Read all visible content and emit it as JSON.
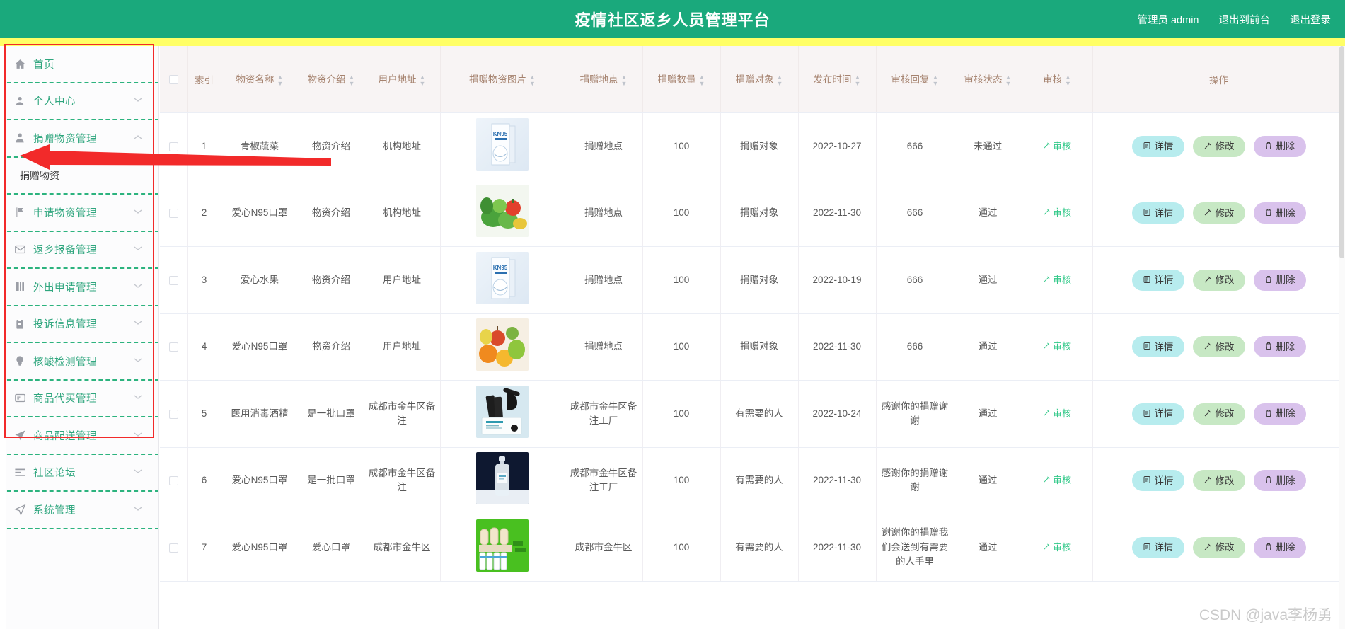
{
  "header": {
    "title": "疫情社区返乡人员管理平台",
    "user_label": "管理员 admin",
    "exit_front_label": "退出到前台",
    "logout_label": "退出登录",
    "bg_color": "#1aa97c",
    "accent_bar_color": "#ffff66"
  },
  "sidebar": {
    "items": [
      {
        "label": "首页",
        "icon": "home-icon",
        "expandable": false,
        "expanded": false
      },
      {
        "label": "个人中心",
        "icon": "user-icon",
        "expandable": true,
        "expanded": false
      },
      {
        "label": "捐赠物资管理",
        "icon": "person-filled-icon",
        "expandable": true,
        "expanded": true
      },
      {
        "label": "申请物资管理",
        "icon": "flag-icon",
        "expandable": true,
        "expanded": false
      },
      {
        "label": "返乡报备管理",
        "icon": "envelope-icon",
        "expandable": true,
        "expanded": false
      },
      {
        "label": "外出申请管理",
        "icon": "book-icon",
        "expandable": true,
        "expanded": false
      },
      {
        "label": "投诉信息管理",
        "icon": "clipboard-icon",
        "expandable": true,
        "expanded": false
      },
      {
        "label": "核酸检测管理",
        "icon": "bulb-icon",
        "expandable": true,
        "expanded": false
      },
      {
        "label": "商品代买管理",
        "icon": "card-icon",
        "expandable": true,
        "expanded": false
      },
      {
        "label": "商品配送管理",
        "icon": "send-icon",
        "expandable": true,
        "expanded": false
      },
      {
        "label": "社区论坛",
        "icon": "list-icon",
        "expandable": true,
        "expanded": false
      },
      {
        "label": "系统管理",
        "icon": "navigation-icon",
        "expandable": true,
        "expanded": false
      }
    ],
    "submenu": {
      "label": "捐赠物资",
      "parent": "捐赠物资管理"
    }
  },
  "table": {
    "columns": [
      {
        "key": "checkbox",
        "label": "",
        "sortable": false
      },
      {
        "key": "index",
        "label": "索引",
        "sortable": false
      },
      {
        "key": "name",
        "label": "物资名称",
        "sortable": true
      },
      {
        "key": "intro",
        "label": "物资介绍",
        "sortable": true
      },
      {
        "key": "user_address",
        "label": "用户地址",
        "sortable": true
      },
      {
        "key": "image",
        "label": "捐赠物资图片",
        "sortable": true
      },
      {
        "key": "place",
        "label": "捐赠地点",
        "sortable": true
      },
      {
        "key": "quantity",
        "label": "捐赠数量",
        "sortable": true
      },
      {
        "key": "target",
        "label": "捐赠对象",
        "sortable": true
      },
      {
        "key": "publish_time",
        "label": "发布时间",
        "sortable": true
      },
      {
        "key": "audit_reply",
        "label": "审核回复",
        "sortable": true
      },
      {
        "key": "audit_status",
        "label": "审核状态",
        "sortable": true
      },
      {
        "key": "audit",
        "label": "审核",
        "sortable": true
      },
      {
        "key": "operations",
        "label": "操作",
        "sortable": false
      }
    ],
    "audit_link_label": "审核",
    "buttons": {
      "detail": "详情",
      "edit": "修改",
      "delete": "删除"
    },
    "rows": [
      {
        "index": "1",
        "name": "青椒蔬菜",
        "intro": "物资介绍",
        "user_address": "机构地址",
        "image": "kn95-box",
        "place": "捐赠地点",
        "quantity": "100",
        "target": "捐赠对象",
        "publish_time": "2022-10-27",
        "audit_reply": "666",
        "audit_status": "未通过"
      },
      {
        "index": "2",
        "name": "爱心N95口罩",
        "intro": "物资介绍",
        "user_address": "机构地址",
        "image": "vegetables",
        "place": "捐赠地点",
        "quantity": "100",
        "target": "捐赠对象",
        "publish_time": "2022-11-30",
        "audit_reply": "666",
        "audit_status": "通过"
      },
      {
        "index": "3",
        "name": "爱心水果",
        "intro": "物资介绍",
        "user_address": "用户地址",
        "image": "kn95-box",
        "place": "捐赠地点",
        "quantity": "100",
        "target": "捐赠对象",
        "publish_time": "2022-10-19",
        "audit_reply": "666",
        "audit_status": "通过"
      },
      {
        "index": "4",
        "name": "爱心N95口罩",
        "intro": "物资介绍",
        "user_address": "用户地址",
        "image": "fruits",
        "place": "捐赠地点",
        "quantity": "100",
        "target": "捐赠对象",
        "publish_time": "2022-11-30",
        "audit_reply": "666",
        "audit_status": "通过"
      },
      {
        "index": "5",
        "name": "医用消毒酒精",
        "intro": "是一批口罩",
        "user_address": "成都市金牛区备注",
        "image": "black-masks",
        "place": "成都市金牛区备注工厂",
        "quantity": "100",
        "target": "有需要的人",
        "publish_time": "2022-10-24",
        "audit_reply": "感谢你的捐赠谢谢",
        "audit_status": "通过"
      },
      {
        "index": "6",
        "name": "爱心N95口罩",
        "intro": "是一批口罩",
        "user_address": "成都市金牛区备注",
        "image": "alcohol-bottle",
        "place": "成都市金牛区备注工厂",
        "quantity": "100",
        "target": "有需要的人",
        "publish_time": "2022-11-30",
        "audit_reply": "感谢你的捐赠谢谢",
        "audit_status": "通过"
      },
      {
        "index": "7",
        "name": "爱心N95口罩",
        "intro": "爱心口罩",
        "user_address": "成都市金牛区",
        "image": "supplies-green",
        "place": "成都市金牛区",
        "quantity": "100",
        "target": "有需要的人",
        "publish_time": "2022-11-30",
        "audit_reply": "谢谢你的捐赠我们会送到有需要的人手里",
        "audit_status": "通过"
      }
    ]
  },
  "watermark": {
    "text": "CSDN @java李杨勇"
  },
  "colors": {
    "brand_green": "#1aa97c",
    "menu_text_green": "#2fa67e",
    "header_cell_bg": "#f8f4f4",
    "header_cell_text": "#a5826e",
    "btn_detail": "#b7ecee",
    "btn_edit": "#c7e8c4",
    "btn_delete": "#d9c2ec",
    "annotation_red": "#f22a2a"
  }
}
